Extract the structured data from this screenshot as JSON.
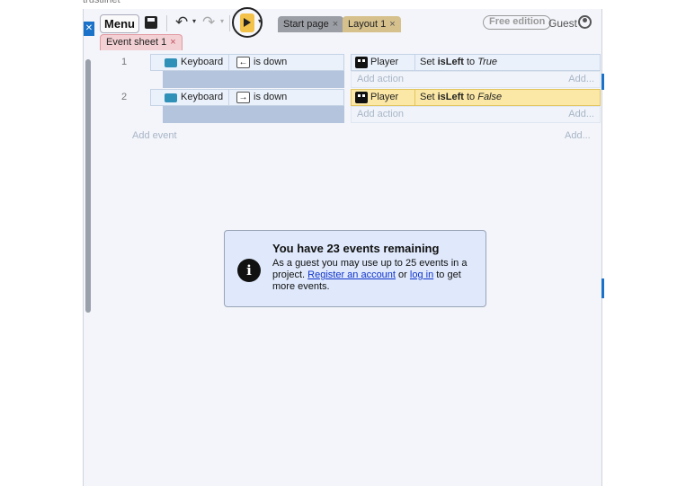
{
  "page": {
    "title": "trustlinet"
  },
  "toolbar": {
    "menu_label": "Menu",
    "save_icon": "save-icon",
    "undo_icon": "undo-icon",
    "redo_icon": "redo-icon",
    "play_icon": "play-icon",
    "undo_glyph": "↶",
    "redo_glyph": "↷",
    "caret_glyph": "▾",
    "tabs": [
      {
        "label": "Start page",
        "close": "×"
      },
      {
        "label": "Layout 1",
        "close": "×"
      }
    ],
    "edition_badge": "Free edition",
    "user_label": "Guest"
  },
  "sheet_tab": {
    "label": "Event sheet 1",
    "close": "×"
  },
  "events": [
    {
      "number": "1",
      "condition": {
        "object": "Keyboard",
        "key_glyph": "←",
        "text": "is down"
      },
      "action": {
        "object": "Player",
        "prefix": "Set ",
        "var": "isLeft",
        "mid": " to ",
        "value": "True",
        "highlighted": false
      },
      "add_action": "Add action",
      "add_action_short": "Add..."
    },
    {
      "number": "2",
      "condition": {
        "object": "Keyboard",
        "key_glyph": "→",
        "text": "is down"
      },
      "action": {
        "object": "Player",
        "prefix": "Set ",
        "var": "isLeft",
        "mid": " to ",
        "value": "False",
        "highlighted": true
      },
      "add_action": "Add action",
      "add_action_short": "Add..."
    }
  ],
  "add_event": {
    "label": "Add event",
    "short": "Add..."
  },
  "notice": {
    "icon": "info-icon",
    "icon_glyph": "i",
    "title": "You have 23 events remaining",
    "text_1": "As a guest you may use up to 25 events in a project. ",
    "link_register": "Register an account",
    "text_2": " or ",
    "link_login": "log in",
    "text_3": " to get more events."
  },
  "colors": {
    "accent": "#1a73c8",
    "play_button": "#f3c24a",
    "highlight_row": "#fbe8a6",
    "notice_bg": "#dfe9fb"
  }
}
